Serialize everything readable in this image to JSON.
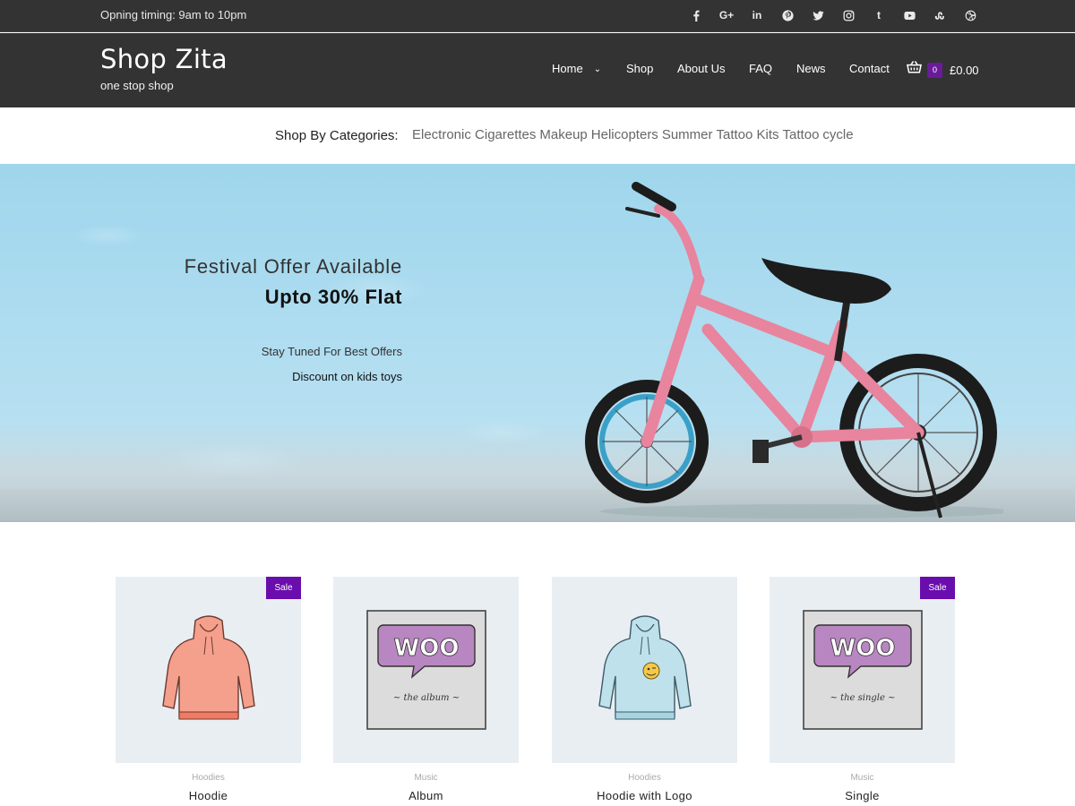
{
  "topbar": {
    "timing": "Opning timing: 9am to 10pm",
    "social": [
      "facebook-icon",
      "google-plus-icon",
      "linkedin-icon",
      "pinterest-icon",
      "twitter-icon",
      "instagram-icon",
      "tumblr-icon",
      "youtube-icon",
      "stumbleupon-icon",
      "dribbble-icon"
    ]
  },
  "header": {
    "title": "Shop Zita",
    "tagline": "one stop shop",
    "nav": [
      {
        "label": "Home"
      },
      {
        "label": "Shop"
      },
      {
        "label": "About Us"
      },
      {
        "label": "FAQ"
      },
      {
        "label": "News"
      },
      {
        "label": "Contact"
      }
    ],
    "cart": {
      "count": "0",
      "total": "£0.00"
    }
  },
  "categories": {
    "label": "Shop By Categories:",
    "items": [
      "Electronic Cigarettes",
      "Makeup",
      "Helicopters",
      "Summer",
      "Tattoo Kits",
      "Tattoo",
      "cycle"
    ]
  },
  "hero": {
    "line1": "Festival Offer Available",
    "line2": "Upto 30% Flat",
    "line3": "Stay Tuned For Best Offers",
    "line4": "Discount on kids toys"
  },
  "products": [
    {
      "category": "Hoodies",
      "name": "Hoodie",
      "sale": "Sale"
    },
    {
      "category": "Music",
      "name": "Album",
      "sale": ""
    },
    {
      "category": "Hoodies",
      "name": "Hoodie with Logo",
      "sale": ""
    },
    {
      "category": "Music",
      "name": "Single",
      "sale": "Sale"
    }
  ],
  "colors": {
    "header_bg": "#333333",
    "accent": "#6a0dad",
    "thumb_bg": "#e9eef3"
  }
}
